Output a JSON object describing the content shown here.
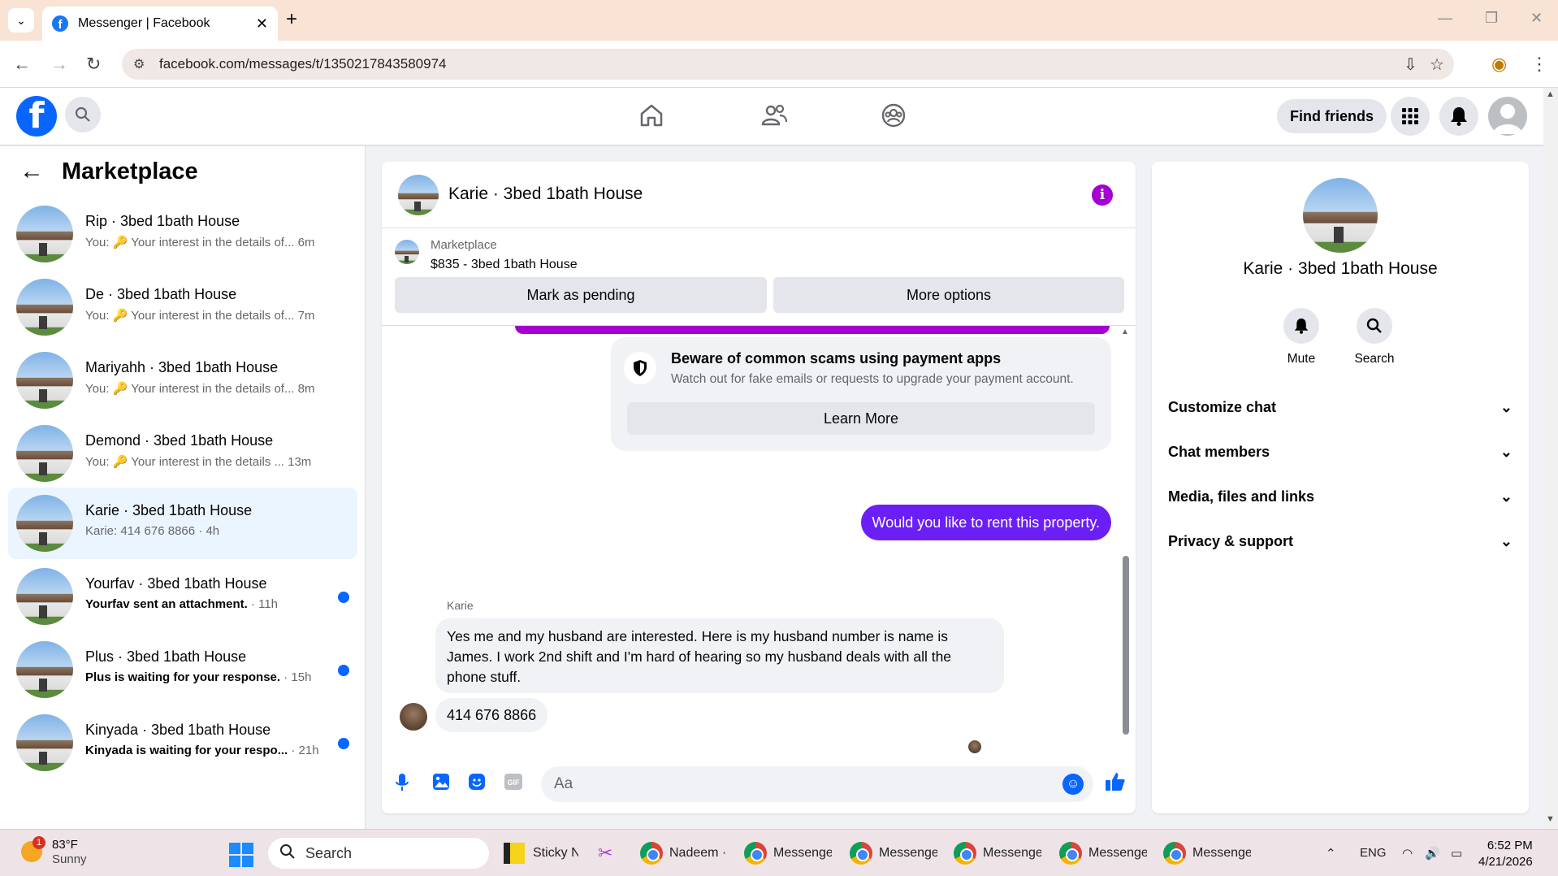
{
  "browser": {
    "tab_title": "Messenger | Facebook",
    "url": "facebook.com/messages/t/1350217843580974"
  },
  "header": {
    "find_friends": "Find friends"
  },
  "sidebar": {
    "title": "Marketplace",
    "conversations": [
      {
        "name": "Rip · 3bed 1bath House",
        "snippet": "You: 🔑 Your interest in the details of...",
        "time": "6m",
        "unread": false,
        "bold": false
      },
      {
        "name": "De · 3bed 1bath House",
        "snippet": "You: 🔑 Your interest in the details of...",
        "time": "7m",
        "unread": false,
        "bold": false
      },
      {
        "name": "Mariyahh · 3bed 1bath House",
        "snippet": "You: 🔑 Your interest in the details of...",
        "time": "8m",
        "unread": false,
        "bold": false
      },
      {
        "name": "Demond · 3bed 1bath House",
        "snippet": "You: 🔑 Your interest in the details ...",
        "time": "13m",
        "unread": false,
        "bold": false
      },
      {
        "name": "Karie · 3bed 1bath House",
        "snippet": "Karie: 414 676 8866 · 4h",
        "time": "",
        "unread": false,
        "bold": false
      },
      {
        "name": "Yourfav · 3bed 1bath House",
        "snippet": "Yourfav sent an attachment.",
        "time": " · 11h",
        "unread": true,
        "bold": true
      },
      {
        "name": "Plus · 3bed 1bath House",
        "snippet": "Plus is waiting for your response.",
        "time": " · 15h",
        "unread": true,
        "bold": true
      },
      {
        "name": "Kinyada · 3bed 1bath House",
        "snippet": "Kinyada is waiting for your respo...",
        "time": " · 21h",
        "unread": true,
        "bold": true
      }
    ]
  },
  "chat": {
    "title": "Karie · 3bed 1bath House",
    "listing_label": "Marketplace",
    "listing_price": "$835 - 3bed 1bath House",
    "mark_pending": "Mark as pending",
    "more_options": "More options",
    "scam_title": "Beware of common scams using payment apps",
    "scam_sub": "Watch out for fake emails or requests to upgrade your payment account.",
    "learn_more": "Learn More",
    "outgoing_message": "Would you like to rent this property.",
    "sender_name": "Karie",
    "incoming_message_1": "Yes me and my husband are interested. Here is my husband number is name is James. I work 2nd shift and I'm hard of hearing so my husband deals with all the phone stuff.",
    "incoming_message_2": "414 676 8866",
    "composer_placeholder": "Aa"
  },
  "info_panel": {
    "name": "Karie · 3bed 1bath House",
    "mute": "Mute",
    "search": "Search",
    "sections": [
      "Customize chat",
      "Chat members",
      "Media, files and links",
      "Privacy & support"
    ]
  },
  "taskbar": {
    "temperature": "83°F",
    "condition": "Sunny",
    "weather_badge": "1",
    "search": "Search",
    "apps": [
      "Sticky N",
      "Nadeem ·",
      "Messenge",
      "Messenge",
      "Messenge",
      "Messenge",
      "Messenge"
    ],
    "lang": "ENG",
    "time": "6:52 PM",
    "date": "4/21/2026"
  },
  "colors": {
    "fb_blue": "#0866ff",
    "purple": "#a400d1",
    "outgoing_bubble": "#6b1ff6",
    "active_row": "#ebf5ff"
  }
}
